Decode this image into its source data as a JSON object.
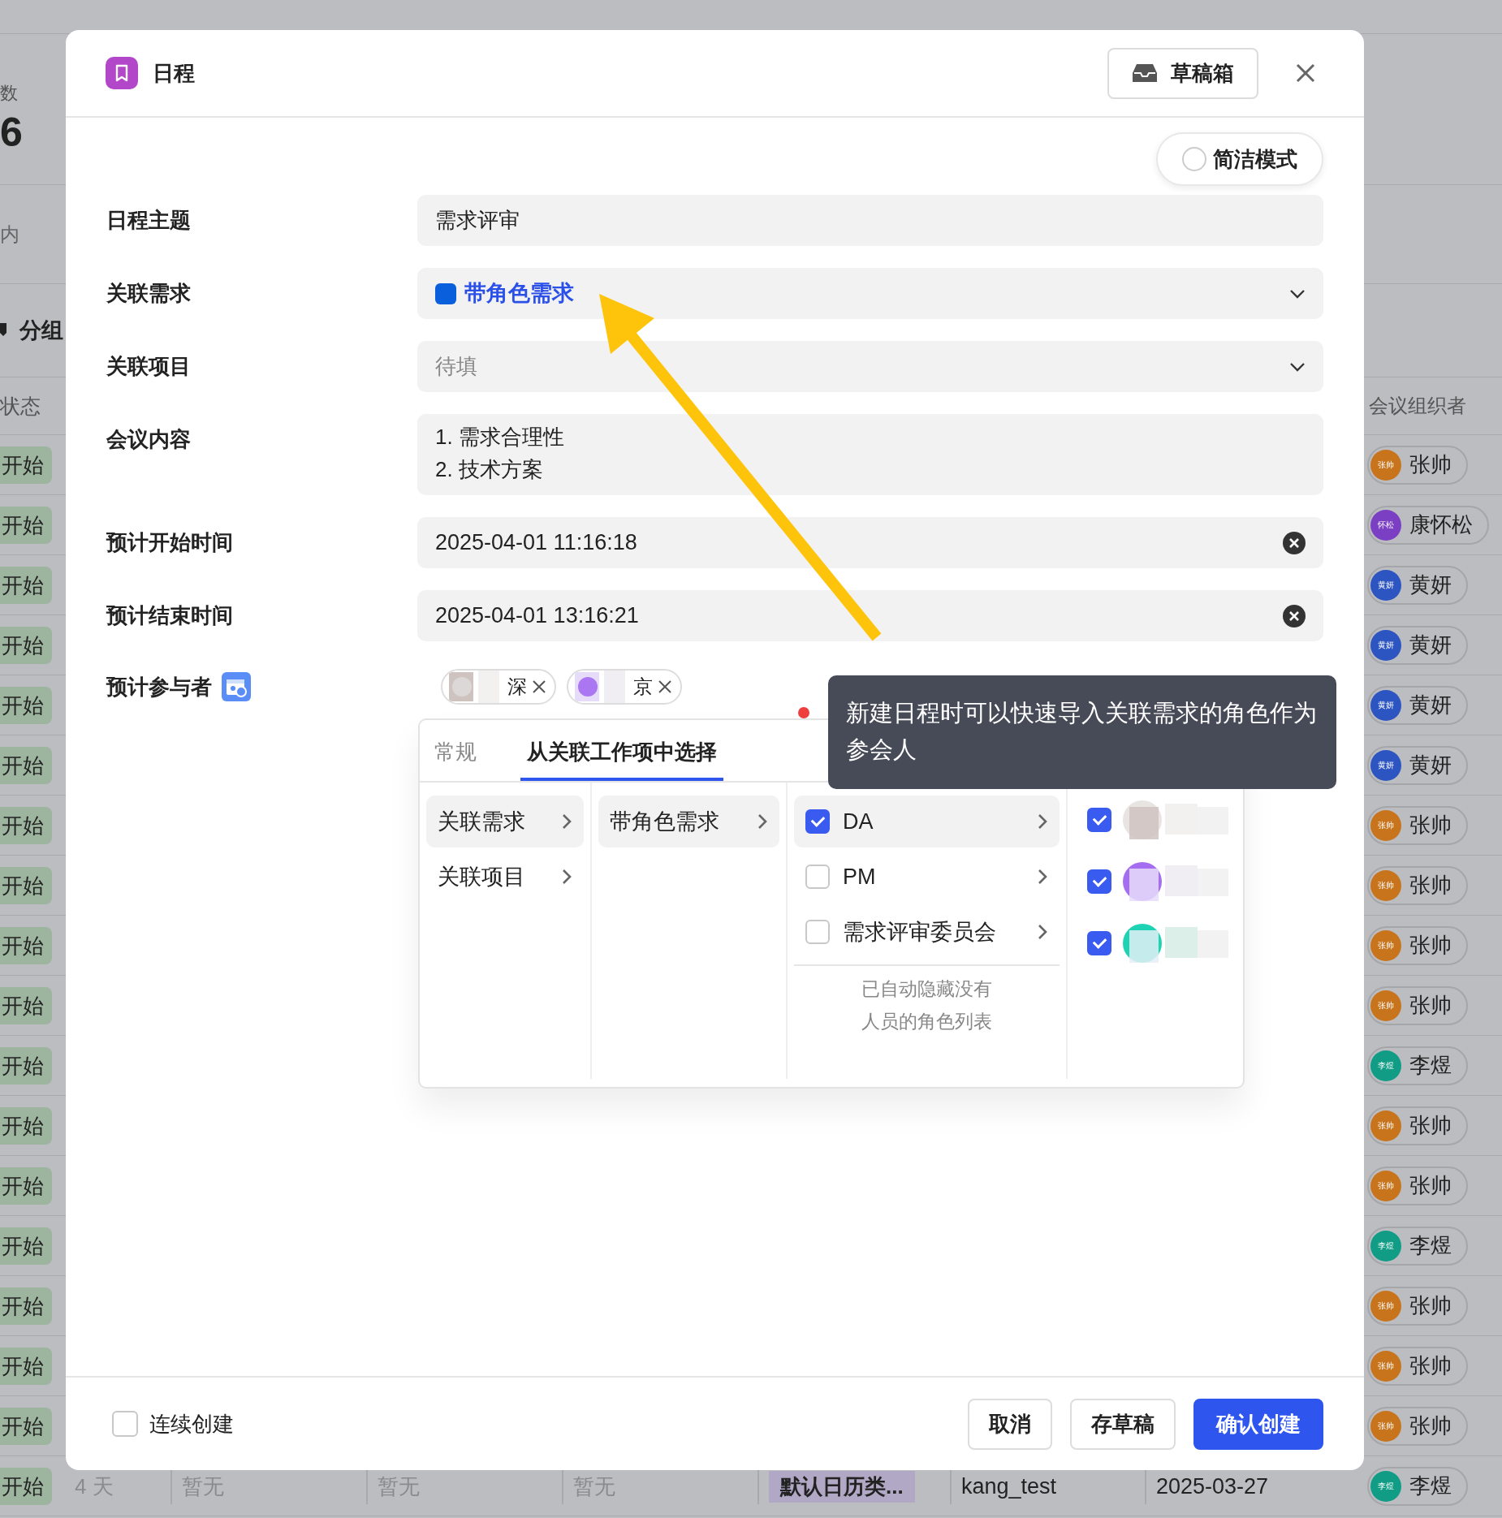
{
  "background": {
    "stat_label": "数",
    "stat_value": "6",
    "filter_text": "内",
    "group_label": "分组",
    "status_header": "状态",
    "organizer_header": "会议组织者",
    "rows": [
      {
        "status": "开始",
        "organizer": "张帅",
        "avatar_text": "张帅",
        "color": "#c8741c"
      },
      {
        "status": "开始",
        "organizer": "康怀松",
        "avatar_text": "怀松",
        "color": "#7b3fc4"
      },
      {
        "status": "开始",
        "organizer": "黄妍",
        "avatar_text": "黄妍",
        "color": "#2d55c2"
      },
      {
        "status": "开始",
        "organizer": "黄妍",
        "avatar_text": "黄妍",
        "color": "#2d55c2"
      },
      {
        "status": "开始",
        "organizer": "黄妍",
        "avatar_text": "黄妍",
        "color": "#2d55c2"
      },
      {
        "status": "开始",
        "organizer": "黄妍",
        "avatar_text": "黄妍",
        "color": "#2d55c2"
      },
      {
        "status": "开始",
        "organizer": "张帅",
        "avatar_text": "张帅",
        "color": "#c8741c"
      },
      {
        "status": "开始",
        "organizer": "张帅",
        "avatar_text": "张帅",
        "color": "#c8741c"
      },
      {
        "status": "开始",
        "organizer": "张帅",
        "avatar_text": "张帅",
        "color": "#c8741c"
      },
      {
        "status": "开始",
        "organizer": "张帅",
        "avatar_text": "张帅",
        "color": "#c8741c"
      },
      {
        "status": "开始",
        "organizer": "李煜",
        "avatar_text": "李煜",
        "color": "#109c85"
      },
      {
        "status": "开始",
        "organizer": "张帅",
        "avatar_text": "张帅",
        "color": "#c8741c"
      },
      {
        "status": "开始",
        "organizer": "张帅",
        "avatar_text": "张帅",
        "color": "#c8741c"
      },
      {
        "status": "开始",
        "organizer": "李煜",
        "avatar_text": "李煜",
        "color": "#109c85"
      },
      {
        "status": "开始",
        "organizer": "张帅",
        "avatar_text": "张帅",
        "color": "#c8741c"
      },
      {
        "status": "开始",
        "organizer": "张帅",
        "avatar_text": "张帅",
        "color": "#c8741c"
      },
      {
        "status": "开始",
        "organizer": "张帅",
        "avatar_text": "张帅",
        "color": "#c8741c"
      },
      {
        "status": "开始",
        "organizer": "李煜",
        "avatar_text": "李煜",
        "color": "#109c85",
        "cells": [
          {
            "kind": "muted",
            "text": "4 天"
          },
          {
            "kind": "muted",
            "text": "暂无"
          },
          {
            "kind": "muted",
            "text": "暂无"
          },
          {
            "kind": "muted",
            "text": "暂无"
          },
          {
            "kind": "tag",
            "text": "默认日历类..."
          },
          {
            "kind": "plain",
            "text": "kang_test"
          },
          {
            "kind": "plain",
            "text": "2025-03-27"
          }
        ]
      }
    ]
  },
  "dialog": {
    "title": "日程",
    "drafts_button": "草稿箱",
    "simple_mode": {
      "label": "简洁模式",
      "on": false
    },
    "fields": [
      {
        "kind": "text",
        "label": "日程主题",
        "value": "需求评审"
      },
      {
        "kind": "select",
        "label": "关联需求",
        "value": "带角色需求"
      },
      {
        "kind": "select",
        "label": "关联项目",
        "placeholder": "待填"
      },
      {
        "kind": "textarea",
        "label": "会议内容",
        "lines": [
          "1. 需求合理性",
          "2. 技术方案"
        ]
      },
      {
        "kind": "datetime",
        "label": "预计开始时间",
        "value": "2025-04-01 11:16:18"
      },
      {
        "kind": "datetime",
        "label": "预计结束时间",
        "value": "2025-04-01 13:16:21"
      }
    ],
    "participants": {
      "label": "预计参与者",
      "chips": [
        {
          "text": "深"
        },
        {
          "text": "京"
        }
      ]
    },
    "picker": {
      "tabs": [
        {
          "label": "常规",
          "selected": false
        },
        {
          "label": "从关联工作项中选择",
          "selected": true
        }
      ],
      "sources": [
        {
          "label": "关联需求",
          "selected": true
        },
        {
          "label": "关联项目",
          "selected": false
        }
      ],
      "items": [
        {
          "label": "带角色需求",
          "selected": true
        }
      ],
      "roles": [
        {
          "label": "DA",
          "checked": true,
          "selected": true
        },
        {
          "label": "PM",
          "checked": false,
          "selected": false
        },
        {
          "label": "需求评审委员会",
          "checked": false,
          "selected": false
        }
      ],
      "hidden_note": "已自动隐藏没有人员的角色列表",
      "members": [
        {
          "checked": true
        },
        {
          "checked": true
        },
        {
          "checked": true
        }
      ]
    },
    "tooltip": "新建日程时可以快速导入关联需求的角色作为参会人",
    "footer": {
      "continuous": {
        "label": "连续创建",
        "checked": false
      },
      "buttons": [
        {
          "label": "取消",
          "kind": "default"
        },
        {
          "label": "存草稿",
          "kind": "default"
        },
        {
          "label": "确认创建",
          "kind": "primary"
        }
      ]
    }
  }
}
